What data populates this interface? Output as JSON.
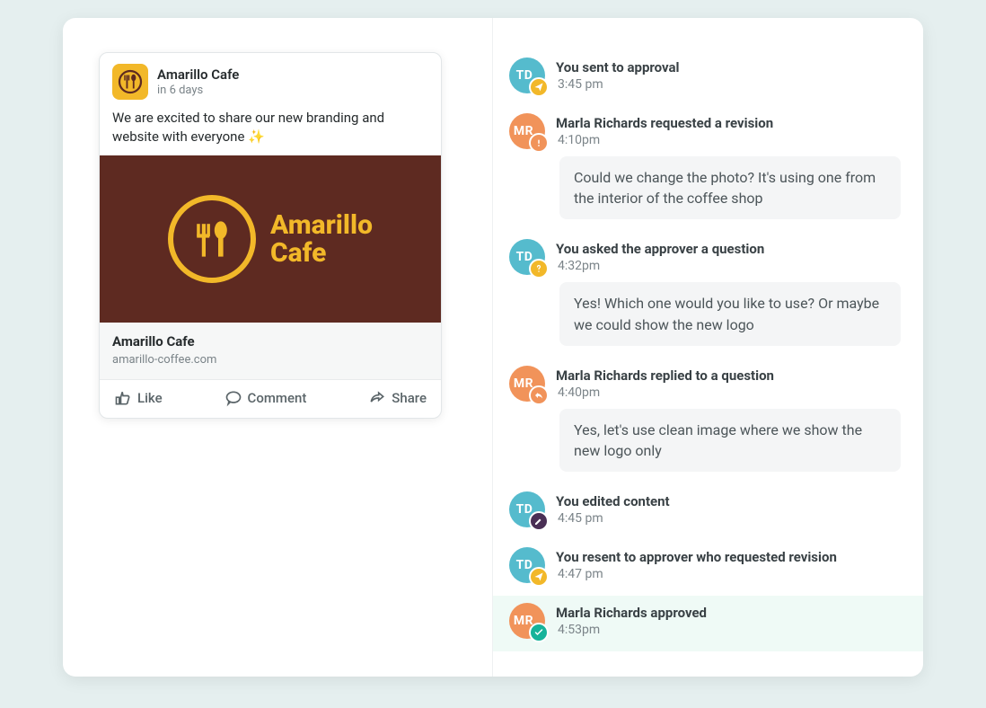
{
  "post": {
    "account_name": "Amarillo Cafe",
    "schedule_text": "in 6 days",
    "body_text": "We are excited to share our new branding and website with everyone ✨",
    "logo_text_line1": "Amarillo",
    "logo_text_line2": "Cafe",
    "link_title": "Amarillo Cafe",
    "link_url": "amarillo-coffee.com",
    "actions": {
      "like": "Like",
      "comment": "Comment",
      "share": "Share"
    }
  },
  "activity": [
    {
      "avatar": "TD",
      "avatar_color": "td",
      "badge": "sent",
      "title": "You sent to approval",
      "time": "3:45 pm"
    },
    {
      "avatar": "MR",
      "avatar_color": "mr",
      "badge": "alert",
      "title": "Marla Richards requested a revision",
      "time": "4:10pm",
      "message": "Could we change the photo? It's using one from the interior of the coffee shop"
    },
    {
      "avatar": "TD",
      "avatar_color": "td",
      "badge": "question",
      "title": "You asked the approver a question",
      "time": "4:32pm",
      "message": "Yes! Which one would you like to use? Or maybe we could show the new logo"
    },
    {
      "avatar": "MR",
      "avatar_color": "mr",
      "badge": "reply",
      "title": "Marla Richards replied to a question",
      "time": "4:40pm",
      "message": "Yes, let's use clean image where we show the new logo only"
    },
    {
      "avatar": "TD",
      "avatar_color": "td",
      "badge": "edit",
      "title": "You edited content",
      "time": "4:45 pm"
    },
    {
      "avatar": "TD",
      "avatar_color": "td",
      "badge": "sent",
      "title": "You resent to approver who requested revision",
      "time": "4:47 pm"
    },
    {
      "avatar": "MR",
      "avatar_color": "mr",
      "badge": "approve",
      "approved": true,
      "title": "Marla Richards approved",
      "time": "4:53pm"
    }
  ]
}
